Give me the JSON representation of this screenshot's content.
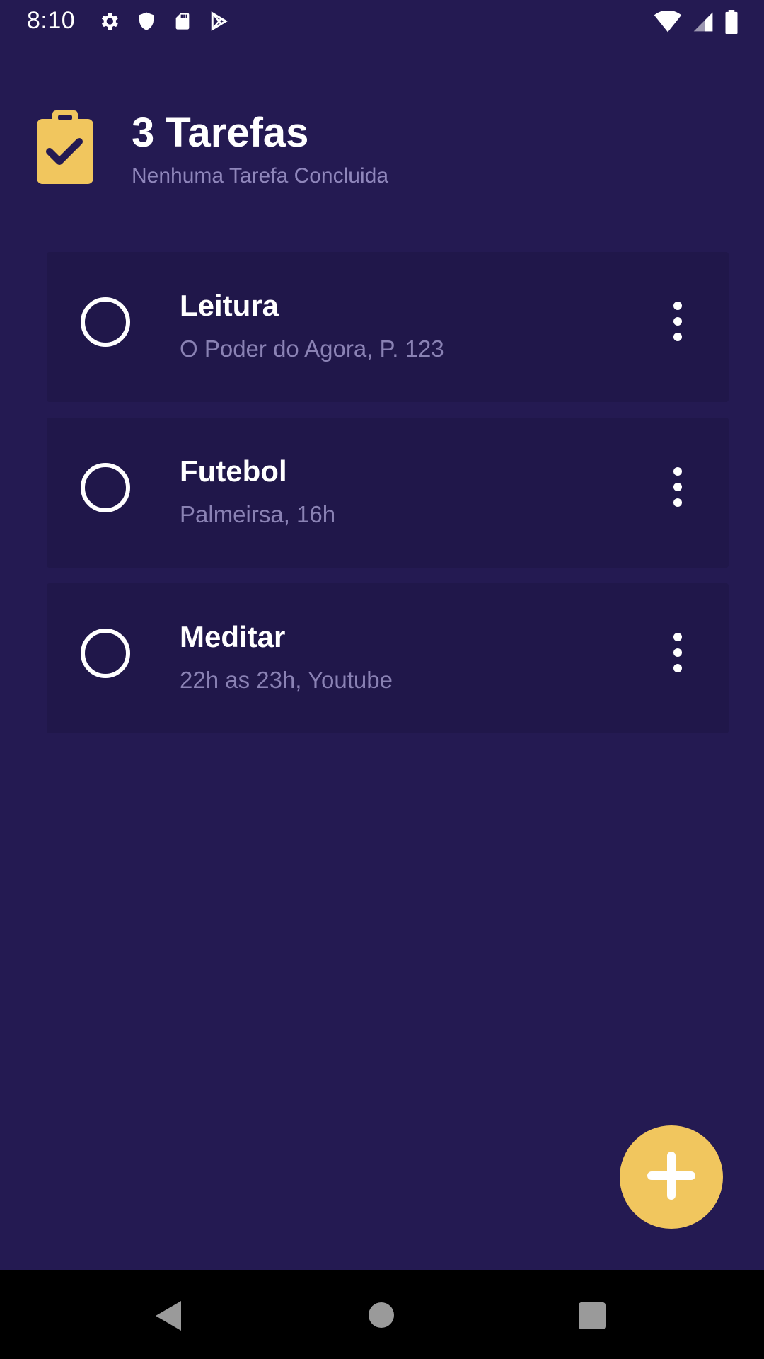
{
  "status_bar": {
    "time": "8:10",
    "icons_left": [
      "gear-icon",
      "shield-icon",
      "sd-card-icon",
      "play-store-icon"
    ],
    "icons_right": [
      "wifi-icon",
      "signal-icon",
      "battery-icon"
    ]
  },
  "header": {
    "title": "3 Tarefas",
    "subtitle": "Nenhuma Tarefa Concluida",
    "logo_icon": "clipboard-check-icon"
  },
  "tasks": [
    {
      "title": "Leitura",
      "description": "O Poder do Agora, P. 123",
      "completed": false
    },
    {
      "title": "Futebol",
      "description": "Palmeirsa, 16h",
      "completed": false
    },
    {
      "title": "Meditar",
      "description": "22h as 23h, Youtube",
      "completed": false
    }
  ],
  "fab": {
    "icon": "plus-icon"
  },
  "nav_bar": {
    "icons": [
      "back-icon",
      "home-icon",
      "recents-icon"
    ]
  },
  "colors": {
    "background": "#241a52",
    "card": "#20174a",
    "accent": "#f1c65e",
    "subtitle": "#8f86bb"
  }
}
